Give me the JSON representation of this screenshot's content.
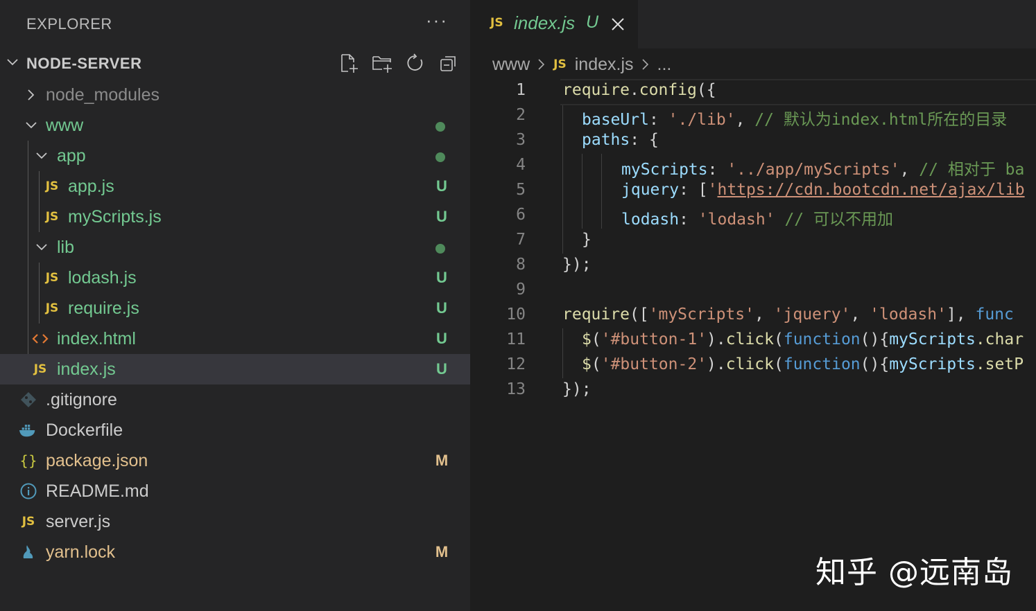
{
  "explorer": {
    "title": "EXPLORER",
    "more": "···",
    "section_title": "NODE-SERVER"
  },
  "tree": [
    {
      "label": "node_modules",
      "kind": "folder-collapsed",
      "badge": ""
    },
    {
      "label": "www",
      "kind": "folder-open",
      "badge": "dot"
    },
    {
      "label": "app",
      "kind": "folder-open",
      "badge": "dot"
    },
    {
      "label": "app.js",
      "kind": "js",
      "badge": "U"
    },
    {
      "label": "myScripts.js",
      "kind": "js",
      "badge": "U"
    },
    {
      "label": "lib",
      "kind": "folder-open",
      "badge": "dot"
    },
    {
      "label": "lodash.js",
      "kind": "js",
      "badge": "U"
    },
    {
      "label": "require.js",
      "kind": "js",
      "badge": "U"
    },
    {
      "label": "index.html",
      "kind": "html",
      "badge": "U"
    },
    {
      "label": "index.js",
      "kind": "js",
      "badge": "U",
      "selected": true
    },
    {
      "label": ".gitignore",
      "kind": "git",
      "badge": ""
    },
    {
      "label": "Dockerfile",
      "kind": "docker",
      "badge": ""
    },
    {
      "label": "package.json",
      "kind": "json",
      "badge": "M"
    },
    {
      "label": "README.md",
      "kind": "info",
      "badge": ""
    },
    {
      "label": "server.js",
      "kind": "js",
      "badge": ""
    },
    {
      "label": "yarn.lock",
      "kind": "yarn",
      "badge": "M"
    }
  ],
  "tab": {
    "icon_text": "JS",
    "name": "index.js",
    "status": "U"
  },
  "breadcrumb": {
    "folder": "www",
    "icon_text": "JS",
    "file": "index.js",
    "more": "..."
  },
  "code_lines": [
    {
      "n": "1"
    },
    {
      "n": "2"
    },
    {
      "n": "3"
    },
    {
      "n": "4"
    },
    {
      "n": "5"
    },
    {
      "n": "6"
    },
    {
      "n": "7"
    },
    {
      "n": "8"
    },
    {
      "n": "9"
    },
    {
      "n": "10"
    },
    {
      "n": "11"
    },
    {
      "n": "12"
    },
    {
      "n": "13"
    }
  ],
  "code": {
    "l1": {
      "a": "require",
      "b": ".",
      "c": "config",
      "d": "({"
    },
    "l2": {
      "a": "baseUrl",
      "b": ": ",
      "c": "'./lib'",
      "d": ", ",
      "e": "// 默认为index.html所在的目录"
    },
    "l3": {
      "a": "paths",
      "b": ": {"
    },
    "l4": {
      "a": "myScripts",
      "b": ": ",
      "c": "'../app/myScripts'",
      "d": ", ",
      "e": "// 相对于 ba"
    },
    "l5": {
      "a": "jquery",
      "b": ": [",
      "c": "'",
      "d": "https://cdn.bootcdn.net/ajax/lib"
    },
    "l6": {
      "a": "lodash",
      "b": ": ",
      "c": "'lodash'",
      "d": " ",
      "e": "// 可以不用加"
    },
    "l7": {
      "a": "}"
    },
    "l8": {
      "a": "});"
    },
    "l10": {
      "a": "require",
      "b": "([",
      "c": "'myScripts'",
      "d": ", ",
      "e": "'jquery'",
      "f": ", ",
      "g": "'lodash'",
      "h": "], ",
      "i": "func"
    },
    "l11": {
      "a": "$",
      "b": "(",
      "c": "'#button-1'",
      "d": ").",
      "e": "click",
      "f": "(",
      "g": "function",
      "h": "(){",
      "i": "myScripts",
      "j": ".char"
    },
    "l12": {
      "a": "$",
      "b": "(",
      "c": "'#button-2'",
      "d": ").",
      "e": "click",
      "f": "(",
      "g": "function",
      "h": "(){",
      "i": "myScripts",
      "j": ".setP"
    },
    "l13": {
      "a": "});"
    }
  },
  "watermark": "知乎 @远南岛",
  "colors": {
    "untracked": "#73c991",
    "modified": "#e2c08d",
    "js_icon": "#e2c040",
    "sidebar_bg": "#252526",
    "editor_bg": "#1e1e1e",
    "selection": "#37373d"
  }
}
